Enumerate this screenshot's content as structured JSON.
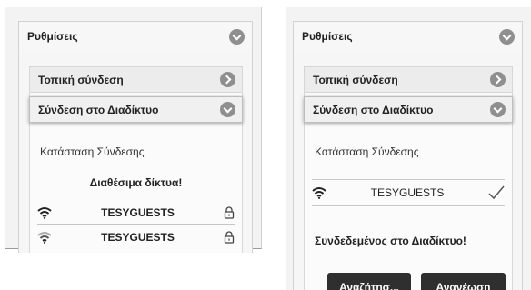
{
  "left": {
    "settings_title": "Ρυθμίσεις",
    "local_connection": "Τοπική σύνδεση",
    "internet_connection": "Σύνδεση στο Διαδίκτυο",
    "connection_status": "Κατάσταση Σύνδεσης",
    "available_networks": "Διαθέσιμα δίκτυα!",
    "networks": [
      {
        "ssid": "TESYGUESTS",
        "icon": "wifi-icon",
        "secured": true
      },
      {
        "ssid": "TESYGUESTS",
        "icon": "wifi-icon",
        "secured": true
      }
    ]
  },
  "right": {
    "settings_title": "Ρυθμίσεις",
    "local_connection": "Τοπική σύνδεση",
    "internet_connection": "Σύνδεση στο Διαδίκτυο",
    "connection_status": "Κατάσταση Σύνδεσης",
    "connected_network": {
      "ssid": "TESYGUESTS",
      "icon": "wifi-icon",
      "status_icon": "checkmark-icon"
    },
    "connected_message": "Συνδεδεμένος στο Διαδίκτυο!",
    "search_button": "Αναζήτησ...",
    "refresh_button": "Ανανέωση"
  },
  "colors": {
    "button_bg": "#2f2f2f",
    "chevron": "#8f8f8f",
    "panel_bg": "#f3f3f3"
  }
}
